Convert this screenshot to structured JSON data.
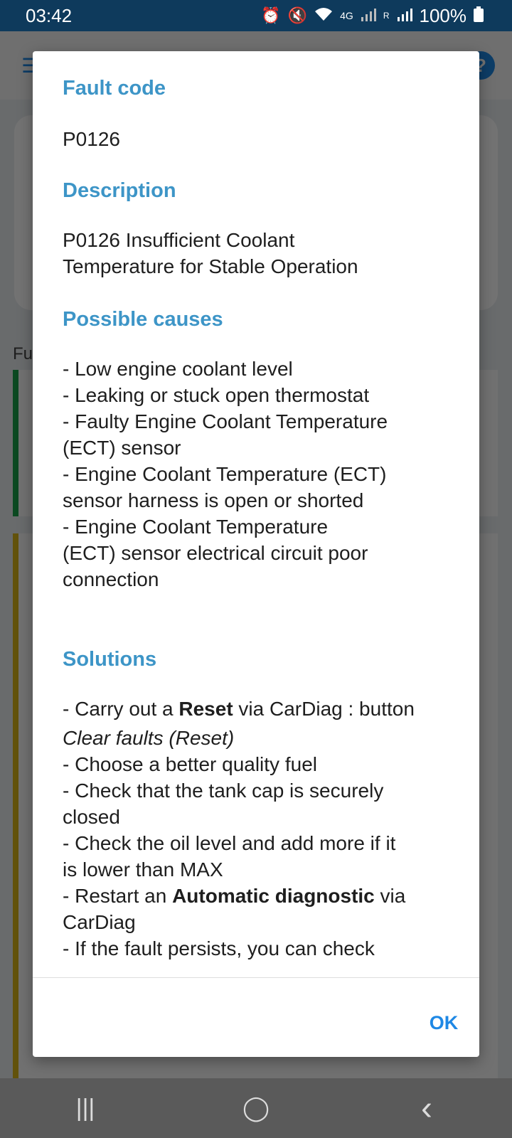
{
  "status_bar": {
    "time": "03:42",
    "network": "4G",
    "roaming": "R",
    "battery": "100%",
    "icons": [
      "alarm-icon",
      "mute-icon",
      "wifi-icon",
      "signal-icon",
      "battery-icon"
    ]
  },
  "background": {
    "section_label": "Fu"
  },
  "dialog": {
    "fault_code_title": "Fault code",
    "fault_code": "P0126",
    "description_title": "Description",
    "description_lines": [
      "P0126 Insufficient Coolant",
      "Temperature for Stable Operation"
    ],
    "causes_title": "Possible causes",
    "causes_lines": [
      "- Low engine coolant level",
      "- Leaking or stuck open thermostat",
      "- Faulty Engine Coolant Temperature",
      "(ECT) sensor",
      "- Engine Coolant Temperature (ECT)",
      "sensor harness is open or shorted",
      "- Engine Coolant Temperature",
      "(ECT) sensor electrical circuit poor",
      "connection"
    ],
    "solutions_title": "Solutions",
    "solutions": {
      "s1_pre": "- Carry out a ",
      "s1_bold": "Reset",
      "s1_post": " via CarDiag : button",
      "s1_italic": "Clear faults (Reset)",
      "s2": "- Choose a better quality fuel",
      "s3a": "- Check that the tank cap is securely",
      "s3b": "closed",
      "s4a": "- Check the oil level and add more if it",
      "s4b": "is lower than MAX",
      "s5_pre": "- Restart an ",
      "s5_bold": "Automatic diagnostic",
      "s5_post": " via",
      "s5b": "CarDiag",
      "s6": "- If the fault persists, you can check"
    },
    "ok_label": "OK"
  },
  "nav_bar": {
    "recents": "|||",
    "home": "◯",
    "back": "‹"
  }
}
